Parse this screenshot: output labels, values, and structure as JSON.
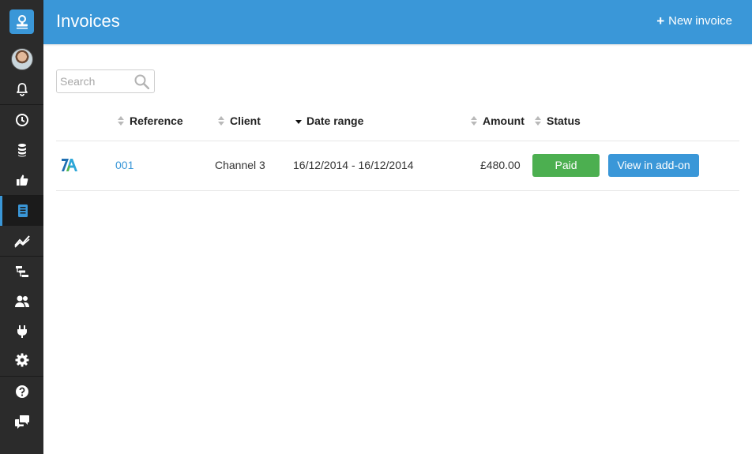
{
  "header": {
    "title": "Invoices",
    "new_invoice_label": "New invoice"
  },
  "search": {
    "placeholder": "Search"
  },
  "sidebar": {
    "items": [
      {
        "icon": "bell-icon"
      },
      {
        "icon": "clock-icon"
      },
      {
        "icon": "database-icon"
      },
      {
        "icon": "thumbs-up-icon"
      },
      {
        "icon": "invoice-icon",
        "active": true
      },
      {
        "icon": "chart-icon"
      },
      {
        "icon": "gantt-icon"
      },
      {
        "icon": "users-icon"
      },
      {
        "icon": "plug-icon"
      },
      {
        "icon": "gear-icon"
      },
      {
        "icon": "help-icon"
      },
      {
        "icon": "chat-icon"
      }
    ]
  },
  "table": {
    "columns": {
      "reference": "Reference",
      "client": "Client",
      "date_range": "Date range",
      "amount": "Amount",
      "status": "Status"
    },
    "rows": [
      {
        "reference": "001",
        "client": "Channel 3",
        "date_range": "16/12/2014 - 16/12/2014",
        "amount": "£480.00",
        "status": "Paid",
        "action": "View in add-on"
      }
    ]
  },
  "colors": {
    "accent": "#3a97d8",
    "sidebar": "#2b2b2b",
    "paid": "#4caf50"
  }
}
